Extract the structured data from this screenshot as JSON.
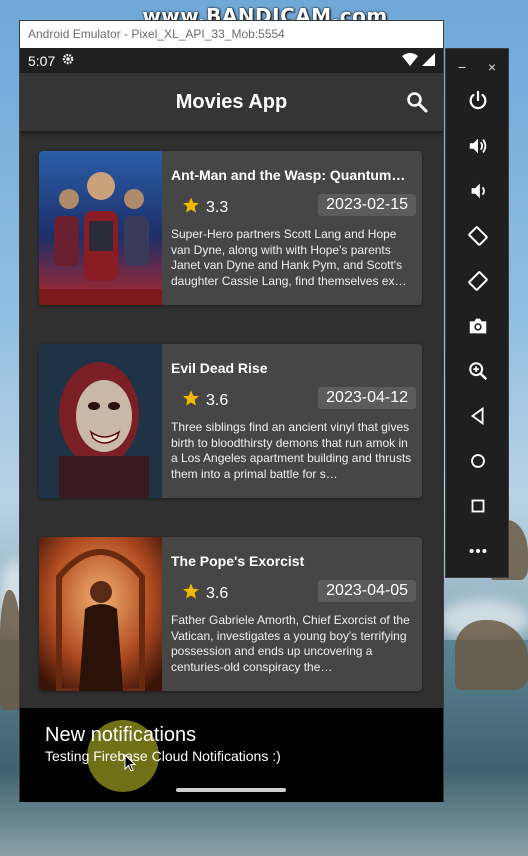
{
  "watermark": "www.BANDICAM.com",
  "emulator": {
    "window_title": "Android Emulator - Pixel_XL_API_33_Mob:5554",
    "side_panel": {
      "window_buttons": [
        "−",
        "×"
      ],
      "buttons": [
        "power-icon",
        "volume-up-icon",
        "volume-down-icon",
        "rotate-left-icon",
        "rotate-right-icon",
        "camera-icon",
        "zoom-icon",
        "back-icon",
        "home-icon",
        "overview-icon",
        "more-icon"
      ]
    }
  },
  "status_bar": {
    "time": "5:07"
  },
  "app_bar": {
    "title": "Movies App"
  },
  "movies": [
    {
      "title": "Ant-Man and the Wasp: Quantum…",
      "rating": "3.3",
      "release_date": "2023-02-15",
      "overview": "Super-Hero partners Scott Lang and Hope van Dyne, along with with Hope's parents Janet van Dyne and Hank Pym, and Scott's daughter Cassie Lang, find themselves ex…"
    },
    {
      "title": "Evil Dead Rise",
      "rating": "3.6",
      "release_date": "2023-04-12",
      "overview": "Three siblings find an ancient vinyl that gives birth to bloodthirsty demons that run amok in a Los Angeles apartment building and thrusts them into a primal battle for s…"
    },
    {
      "title": "The Pope's Exorcist",
      "rating": "3.6",
      "release_date": "2023-04-05",
      "overview": "Father Gabriele Amorth, Chief Exorcist of the Vatican, investigates a young boy's terrifying possession and ends up uncovering a centuries-old conspiracy the…"
    }
  ],
  "notification": {
    "title": "New notifications",
    "body": "Testing Firebase Cloud Notifications :)"
  },
  "colors": {
    "star": "#f5b800",
    "card": "#464646",
    "app_bar": "#353535",
    "background": "#303030"
  }
}
